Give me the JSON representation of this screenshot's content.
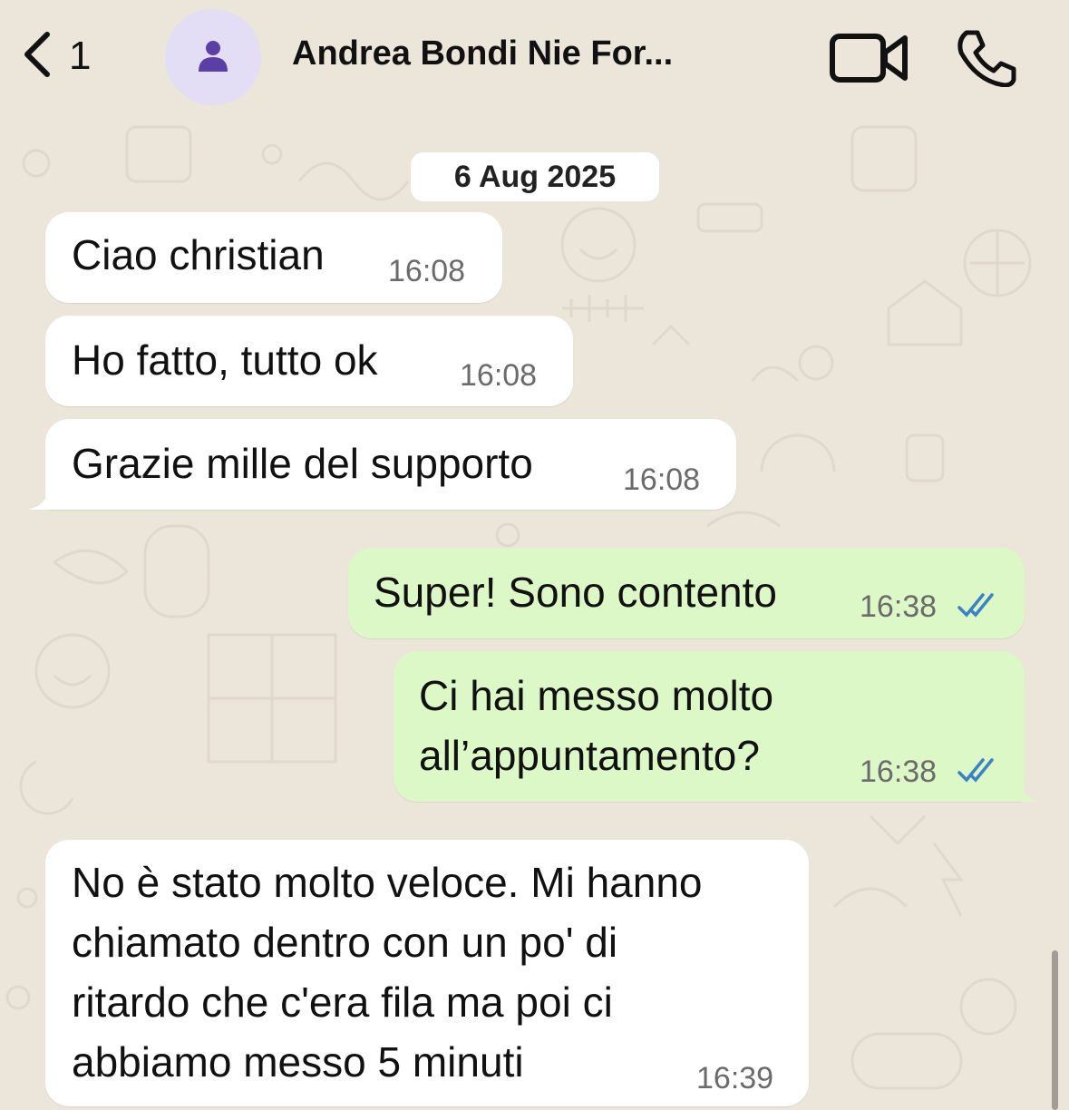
{
  "header": {
    "back_count": "1",
    "contact_name": "Andrea Bondi Nie For...",
    "icons": {
      "back": "chevron-left-icon",
      "avatar": "person-icon",
      "video": "video-camera-icon",
      "call": "phone-icon"
    }
  },
  "date_label": "6 Aug 2025",
  "messages": [
    {
      "direction": "incoming",
      "text": "Ciao christian",
      "time": "16:08"
    },
    {
      "direction": "incoming",
      "text": "Ho fatto, tutto ok",
      "time": "16:08"
    },
    {
      "direction": "incoming",
      "text": "Grazie mille del supporto",
      "time": "16:08"
    },
    {
      "direction": "outgoing",
      "text": "Super! Sono contento",
      "time": "16:38",
      "status": "read"
    },
    {
      "direction": "outgoing",
      "lines": [
        "Ci hai messo molto",
        "all’appuntamento?"
      ],
      "time": "16:38",
      "status": "read"
    },
    {
      "direction": "incoming",
      "lines": [
        "No è stato molto veloce. Mi hanno",
        "chiamato dentro con un po' di",
        "ritardo che c'era fila ma poi ci",
        "abbiamo messo 5 minuti"
      ],
      "time": "16:39"
    }
  ],
  "colors": {
    "wallpaper": "#ECE5DA",
    "incoming_bubble": "#FFFFFF",
    "outgoing_bubble": "#DCF8C6",
    "read_ticks": "#3B82C4",
    "avatar_bg": "#E3DDF5",
    "avatar_icon": "#5B3FA6"
  }
}
